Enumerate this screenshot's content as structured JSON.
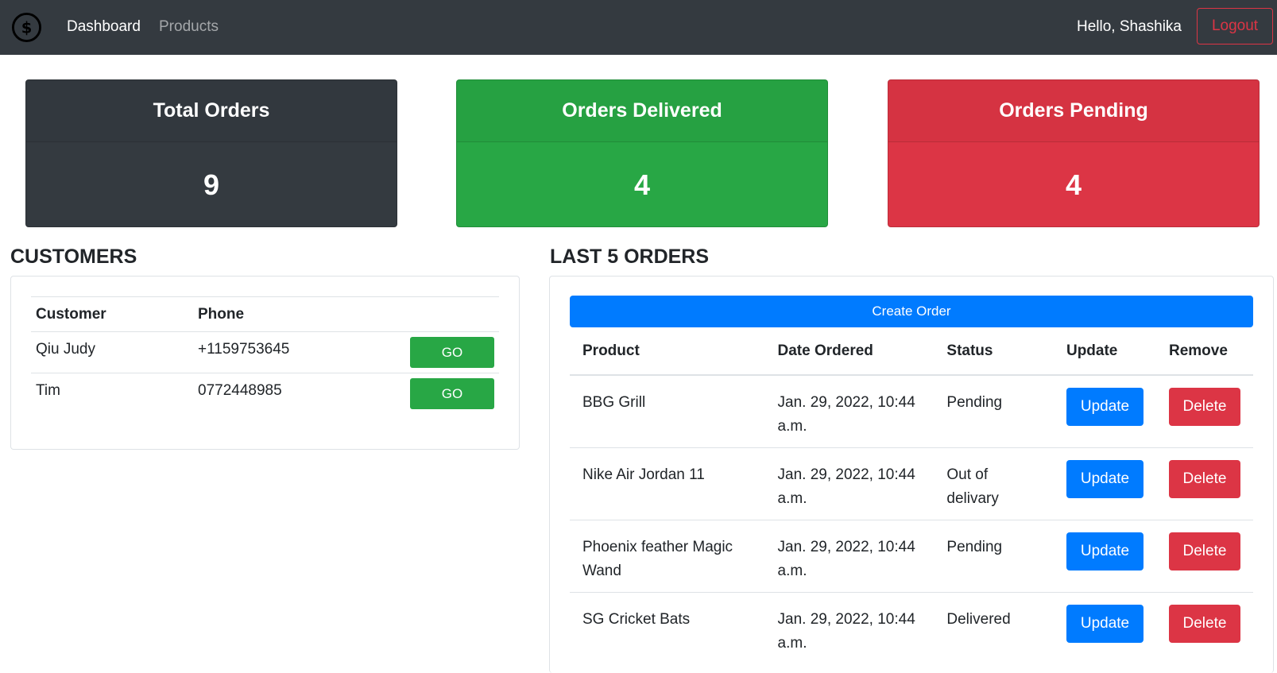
{
  "navbar": {
    "logo_icon": "dollar-circle-icon",
    "links": [
      {
        "label": "Dashboard",
        "active": true
      },
      {
        "label": "Products",
        "active": false
      }
    ],
    "greeting": "Hello, Shashika",
    "logout_label": "Logout"
  },
  "stats": [
    {
      "title": "Total Orders",
      "value": "9",
      "color": "#343a40"
    },
    {
      "title": "Orders Delivered",
      "value": "4",
      "color": "#28a745"
    },
    {
      "title": "Orders Pending",
      "value": "4",
      "color": "#dc3545"
    }
  ],
  "customers": {
    "title": "CUSTOMERS",
    "headers": [
      "Customer",
      "Phone"
    ],
    "rows": [
      {
        "name": "Qiu Judy",
        "phone": "+1159753645",
        "action": "GO"
      },
      {
        "name": "Tim",
        "phone": "0772448985",
        "action": "GO"
      }
    ]
  },
  "orders": {
    "title": "LAST 5 ORDERS",
    "create_label": "Create Order",
    "headers": [
      "Product",
      "Date Ordered",
      "Status",
      "Update",
      "Remove"
    ],
    "rows": [
      {
        "product": "BBG Grill",
        "date": "Jan. 29, 2022, 10:44 a.m.",
        "status": "Pending",
        "update": "Update",
        "remove": "Delete"
      },
      {
        "product": "Nike Air Jordan 11",
        "date": "Jan. 29, 2022, 10:44 a.m.",
        "status": "Out of delivary",
        "update": "Update",
        "remove": "Delete"
      },
      {
        "product": "Phoenix feather Magic Wand",
        "date": "Jan. 29, 2022, 10:44 a.m.",
        "status": "Pending",
        "update": "Update",
        "remove": "Delete"
      },
      {
        "product": "SG Cricket Bats",
        "date": "Jan. 29, 2022, 10:44 a.m.",
        "status": "Delivered",
        "update": "Update",
        "remove": "Delete"
      }
    ]
  }
}
